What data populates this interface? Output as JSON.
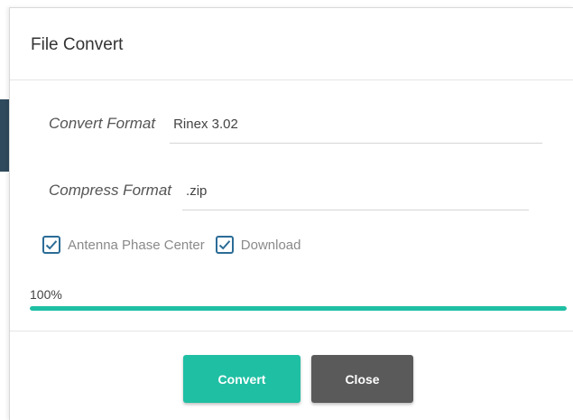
{
  "dialog": {
    "title": "File Convert"
  },
  "convert_format": {
    "label": "Convert Format",
    "value": "Rinex 3.02"
  },
  "compress_format": {
    "label": "Compress Format",
    "value": ".zip"
  },
  "options": [
    {
      "label": "Antenna Phase Center",
      "checked": true
    },
    {
      "label": "Download",
      "checked": true
    }
  ],
  "progress": {
    "text": "100%",
    "value": 1.0
  },
  "buttons": {
    "convert": "Convert",
    "close": "Close"
  },
  "colors": {
    "accent": "#1fbfa3",
    "close_button": "#5a5a5a",
    "checkbox_border": "#2b6c97"
  },
  "icons": {
    "checkbox": "checkmark-icon"
  }
}
